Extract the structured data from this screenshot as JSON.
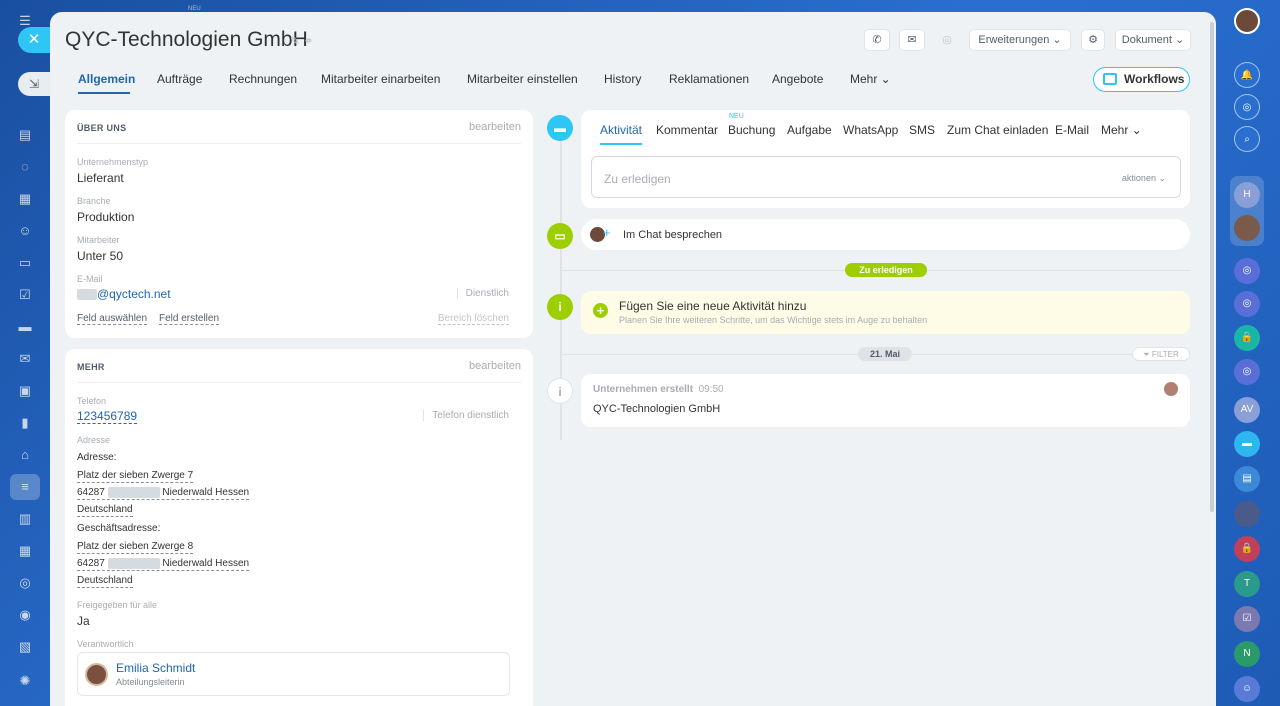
{
  "left_sidebar": {
    "badge": "NEU"
  },
  "page": {
    "title": "QYC-Technologien GmbH"
  },
  "header": {
    "erweiterungen": "Erweiterungen",
    "dokument": "Dokument"
  },
  "tabs": [
    {
      "label": "Allgemein"
    },
    {
      "label": "Aufträge"
    },
    {
      "label": "Rechnungen"
    },
    {
      "label": "Mitarbeiter einarbeiten"
    },
    {
      "label": "Mitarbeiter einstellen"
    },
    {
      "label": "History"
    },
    {
      "label": "Reklamationen"
    },
    {
      "label": "Angebote"
    },
    {
      "label": "Mehr"
    }
  ],
  "workflows_label": "Workflows",
  "about": {
    "header": "ÜBER UNS",
    "edit": "bearbeiten",
    "type_label": "Unternehmenstyp",
    "type_value": "Lieferant",
    "industry_label": "Branche",
    "industry_value": "Produktion",
    "employees_label": "Mitarbeiter",
    "employees_value": "Unter 50",
    "email_label": "E-Mail",
    "email_value": "@qyctech.net",
    "email_type": "Dienstlich",
    "select_field": "Feld auswählen",
    "create_field": "Feld erstellen",
    "delete_section": "Bereich löschen"
  },
  "more": {
    "header": "MEHR",
    "edit": "bearbeiten",
    "phone_label": "Telefon",
    "phone_value": "123456789",
    "phone_type": "Telefon dienstlich",
    "address_label": "Adresse",
    "address_sub": "Adresse:",
    "address_line1": "Platz der sieben Zwerge 7",
    "address_zip": "64287",
    "address_city": "Niederwald Hessen",
    "address_country": "Deutschland",
    "business_sub": "Geschäftsadresse:",
    "business_line1": "Platz der sieben Zwerge 8",
    "business_zip": "64287",
    "business_city": "Niederwald Hessen",
    "business_country": "Deutschland",
    "shared_label": "Freigegeben für alle",
    "shared_value": "Ja",
    "responsible_label": "Verantwortlich",
    "responsible_name": "Emilia Schmidt",
    "responsible_role": "Abteilungsleiterin"
  },
  "activity": {
    "tabs": [
      {
        "label": "Aktivität"
      },
      {
        "label": "Kommentar"
      },
      {
        "label": "Buchung"
      },
      {
        "label": "Aufgabe"
      },
      {
        "label": "WhatsApp"
      },
      {
        "label": "SMS"
      },
      {
        "label": "Zum Chat einladen"
      },
      {
        "label": "E-Mail"
      },
      {
        "label": "Mehr"
      }
    ],
    "new_badge": "NEU",
    "placeholder": "Zu erledigen",
    "actions": "aktionen"
  },
  "timeline": {
    "chat_label": "Im Chat besprechen",
    "todo_pill": "Zu erledigen",
    "add_title": "Fügen Sie eine neue Aktivität hinzu",
    "add_sub": "Planen Sie Ihre weiteren Schritte, um das Wichtige stets im Auge zu behalten",
    "date_pill": "21. Mai",
    "filter": "FILTER",
    "created_label": "Unternehmen erstellt",
    "created_time": "09:50",
    "created_company": "QYC-Technologien GmbH"
  },
  "colors": {
    "accent": "#2067b0",
    "cyan": "#2fc6f6",
    "green": "#9dcf00",
    "panel": "#eef2f4"
  }
}
